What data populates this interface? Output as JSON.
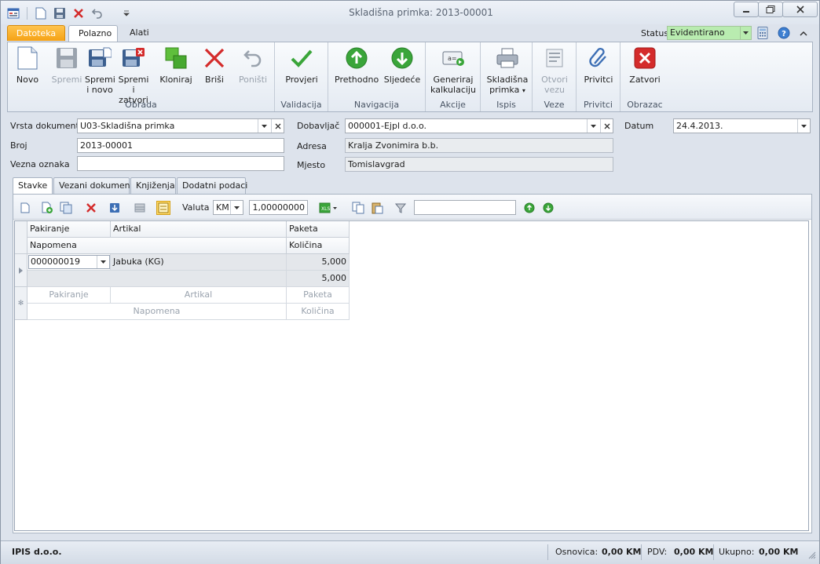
{
  "window": {
    "title": "Skladišna primka: 2013-00001"
  },
  "ribbon_tabs": {
    "file": "Datoteka",
    "home": "Polazno",
    "tools": "Alati"
  },
  "status": {
    "label": "Status",
    "value": "Evidentirano"
  },
  "ribbon": {
    "groups": {
      "obrada": "Obrada",
      "validacija": "Validacija",
      "navigacija": "Navigacija",
      "akcije": "Akcije",
      "ispis": "Ispis",
      "veze": "Veze",
      "privitci": "Privitci",
      "obrazac": "Obrazac"
    },
    "buttons": {
      "novo": "Novo",
      "spremi": "Spremi",
      "spremi_novo_1": "Spremi",
      "spremi_novo_2": "i novo",
      "spremi_zatvori_1": "Spremi i",
      "spremi_zatvori_2": "zatvori",
      "kloniraj": "Kloniraj",
      "brisi": "Briši",
      "ponisti": "Poništi",
      "provjeri": "Provjeri",
      "prethodno": "Prethodno",
      "sljedece": "Sljedeće",
      "generiraj_1": "Generiraj",
      "generiraj_2": "kalkulaciju",
      "primka_1": "Skladišna",
      "primka_2": "primka",
      "otvori_1": "Otvori",
      "otvori_2": "vezu",
      "privitci": "Privitci",
      "zatvori": "Zatvori"
    }
  },
  "form": {
    "vrsta_label": "Vrsta dokumenta",
    "vrsta_value": "U03-Skladišna primka",
    "broj_label": "Broj",
    "broj_value": "2013-00001",
    "vezna_label": "Vezna oznaka",
    "vezna_value": "",
    "dobavljac_label": "Dobavljač",
    "dobavljac_value": "000001-Ejpl d.o.o.",
    "adresa_label": "Adresa",
    "adresa_value": "Kralja Zvonimira b.b.",
    "mjesto_label": "Mjesto",
    "mjesto_value": "Tomislavgrad",
    "datum_label": "Datum",
    "datum_value": "24.4.2013."
  },
  "doc_tabs": [
    "Stavke",
    "Vezani dokumenti",
    "Knjiženja",
    "Dodatni podaci"
  ],
  "toolbar": {
    "valuta_label": "Valuta",
    "valuta_value": "KM",
    "rate_value": "1,00000000",
    "filter_value": ""
  },
  "grid": {
    "headers": {
      "pakiranje": "Pakiranje",
      "artikal": "Artikal",
      "paketa": "Paketa",
      "napomena": "Napomena",
      "kolicina": "Količina"
    },
    "row": {
      "pakiranje": "000000019",
      "artikal": "Jabuka (KG)",
      "paketa": "5,000",
      "kolicina": "5,000"
    },
    "new_row": {
      "pakiranje": "Pakiranje",
      "artikal": "Artikal",
      "paketa": "Paketa",
      "napomena": "Napomena",
      "kolicina": "Količina"
    }
  },
  "statusbar": {
    "company": "IPIS d.o.o.",
    "osnovica_label": "Osnovica:",
    "osnovica_value": "0,00 KM",
    "pdv_label": "PDV:",
    "pdv_value": "0,00 KM",
    "ukupno_label": "Ukupno:",
    "ukupno_value": "0,00 KM"
  },
  "colors": {
    "accent_file": "#f5a215",
    "status_green": "#b9ecb0",
    "delete_red": "#d42b2b",
    "green_icon": "#3aa53a"
  }
}
